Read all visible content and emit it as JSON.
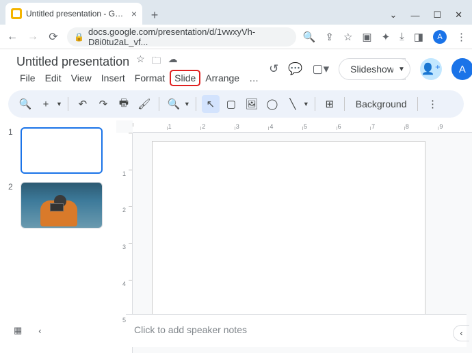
{
  "browser": {
    "tab_title": "Untitled presentation - Google Slides",
    "url": "docs.google.com/presentation/d/1vwxyVh-D8i0tu2aL_vf..."
  },
  "doc": {
    "title": "Untitled presentation",
    "avatar_letter": "A"
  },
  "menus": [
    "File",
    "Edit",
    "View",
    "Insert",
    "Format",
    "Slide",
    "Arrange",
    "…"
  ],
  "highlighted_menu_index": 5,
  "slideshow_label": "Slideshow",
  "toolbar": {
    "background": "Background"
  },
  "ruler_h": [
    "",
    "1",
    "2",
    "3",
    "4",
    "5",
    "6",
    "7",
    "8",
    "9"
  ],
  "ruler_v": [
    "",
    "1",
    "2",
    "3",
    "4",
    "5"
  ],
  "thumbs": [
    {
      "num": "1",
      "selected": true,
      "has_image": false
    },
    {
      "num": "2",
      "selected": false,
      "has_image": true
    }
  ],
  "notes_placeholder": "Click to add speaker notes"
}
